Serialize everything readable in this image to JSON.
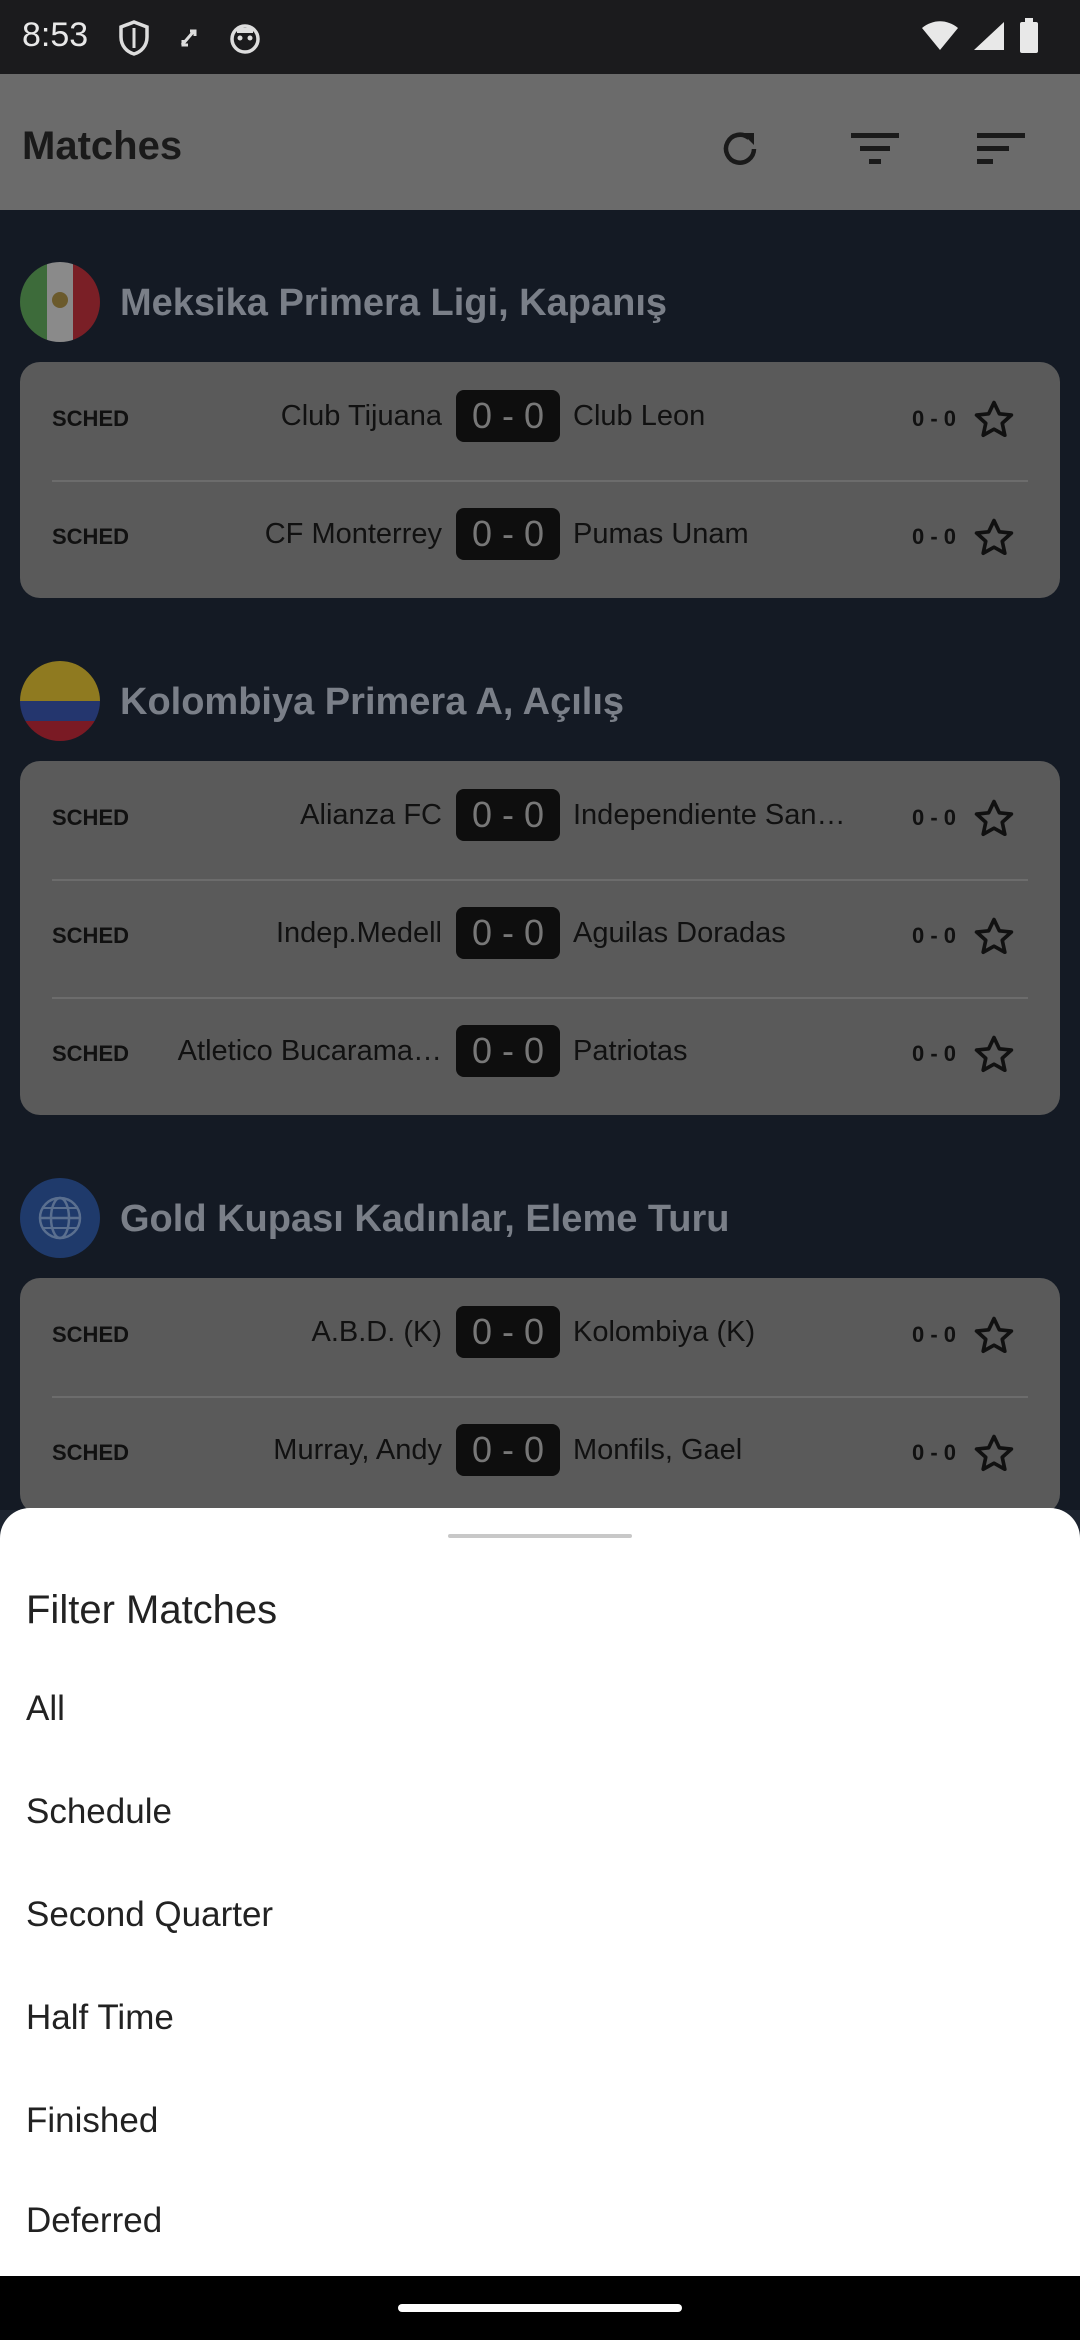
{
  "status_bar": {
    "time": "8:53"
  },
  "app_bar": {
    "title": "Matches"
  },
  "leagues": [
    {
      "name": "Meksika Primera Ligi, Kapanış",
      "matches": [
        {
          "status": "SCHED",
          "home": "Club Tijuana",
          "score": "0 - 0",
          "away": "Club Leon",
          "mini_score": "0 - 0"
        },
        {
          "status": "SCHED",
          "home": "CF Monterrey",
          "score": "0 - 0",
          "away": "Pumas Unam",
          "mini_score": "0 - 0"
        }
      ]
    },
    {
      "name": "Kolombiya Primera A, Açılış",
      "matches": [
        {
          "status": "SCHED",
          "home": "Alianza FC",
          "score": "0 - 0",
          "away": "Independiente San…",
          "mini_score": "0 - 0"
        },
        {
          "status": "SCHED",
          "home": "Indep.Medell",
          "score": "0 - 0",
          "away": "Aguilas Doradas",
          "mini_score": "0 - 0"
        },
        {
          "status": "SCHED",
          "home": "Atletico Bucarama…",
          "score": "0 - 0",
          "away": "Patriotas",
          "mini_score": "0 - 0"
        }
      ]
    },
    {
      "name": "Gold Kupası Kadınlar, Eleme Turu",
      "matches": [
        {
          "status": "SCHED",
          "home": "A.B.D. (K)",
          "score": "0 - 0",
          "away": "Kolombiya (K)",
          "mini_score": "0 - 0"
        },
        {
          "status": "SCHED",
          "home": "Murray, Andy",
          "score": "0 - 0",
          "away": "Monfils, Gael",
          "mini_score": "0 - 0"
        }
      ]
    }
  ],
  "filter_sheet": {
    "title": "Filter Matches",
    "options": [
      "All",
      "Schedule",
      "Second Quarter",
      "Half Time",
      "Finished",
      "Deferred"
    ]
  }
}
